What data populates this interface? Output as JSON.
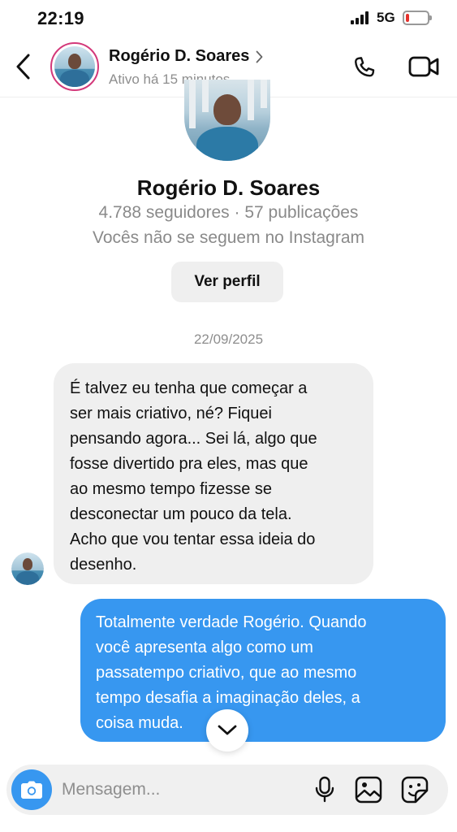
{
  "status_bar": {
    "time": "22:19",
    "network": "5G",
    "battery_level": 0.15,
    "battery_color": "#e5322d"
  },
  "header": {
    "contact_name": "Rogério D. Soares",
    "activity": "Ativo há 15 minutos",
    "icons": [
      "chevron-left-icon",
      "chevron-right-icon",
      "phone-icon",
      "video-camera-icon"
    ]
  },
  "profile": {
    "name": "Rogério D. Soares",
    "stats": "4.788 seguidores · 57 publicações",
    "follow_status": "Vocês não se seguem no Instagram",
    "view_profile_label": "Ver perfil"
  },
  "conversation": {
    "date": "22/09/2025",
    "messages": [
      {
        "direction": "incoming",
        "lines": [
          "É talvez eu tenha que começar a",
          "ser mais criativo, né? Fiquei",
          "pensando agora... Sei lá, algo que",
          "fosse divertido pra eles, mas que",
          "ao mesmo tempo fizesse se",
          "desconectar um pouco da tela.",
          "Acho que vou tentar essa ideia do",
          "desenho."
        ]
      },
      {
        "direction": "outgoing",
        "lines": [
          "Totalmente verdade Rogério. Quando",
          "você apresenta algo como um",
          "passatempo criativo, que ao mesmo",
          "tempo desafia a imaginação deles, a",
          "coisa muda."
        ]
      }
    ]
  },
  "composer": {
    "placeholder": "Mensagem...",
    "icons": [
      "camera-icon",
      "microphone-icon",
      "image-icon",
      "sticker-icon"
    ]
  },
  "colors": {
    "accent_blue": "#3797f0",
    "incoming_bubble": "#efefef",
    "story_ring": "#d3397a",
    "secondary_text": "#8e8e8e"
  }
}
